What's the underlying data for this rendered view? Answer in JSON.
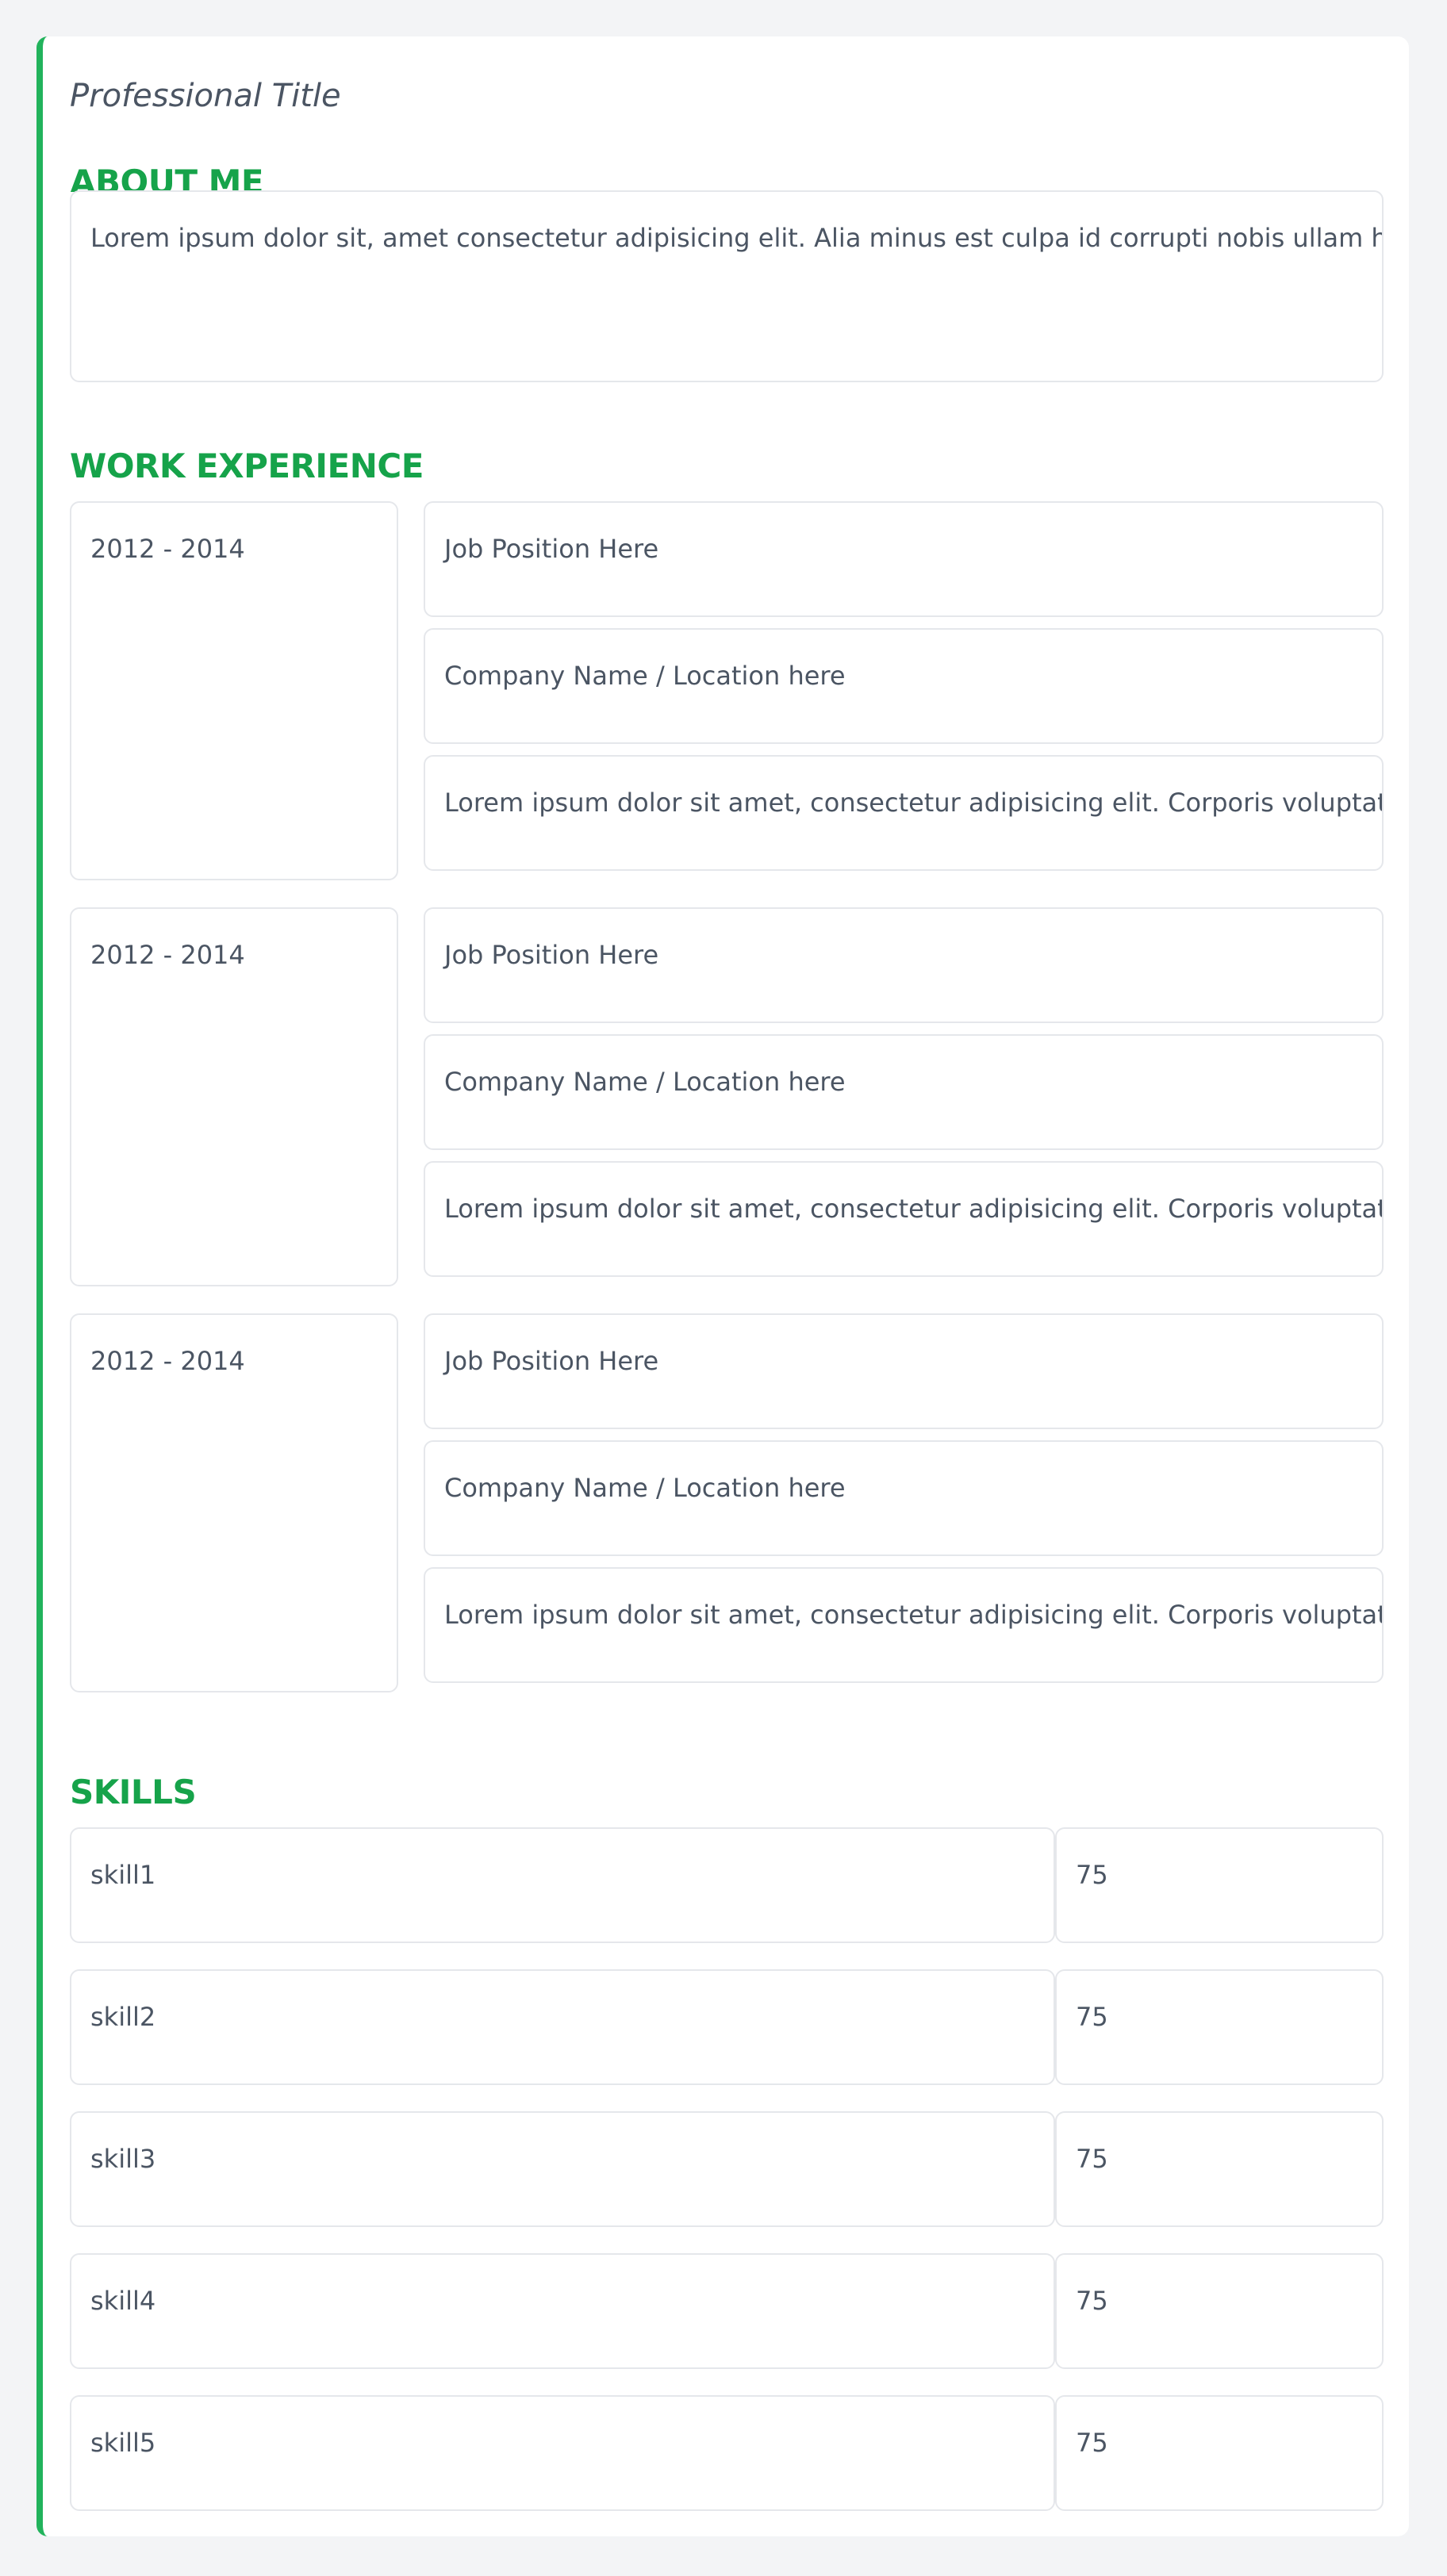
{
  "header": {
    "professional_title": "Professional Title"
  },
  "about": {
    "heading": "ABOUT ME",
    "text": "Lorem ipsum dolor sit, amet consectetur adipisicing elit. Alia minus est culpa id corrupti nobis ullam harum"
  },
  "work": {
    "heading": "WORK EXPERIENCE",
    "entries": [
      {
        "dates": "2012 - 2014",
        "position": "Job Position Here",
        "company": "Company Name / Location here",
        "description": "Lorem ipsum dolor sit amet, consectetur adipisicing elit. Corporis voluptatibus"
      },
      {
        "dates": "2012 - 2014",
        "position": "Job Position Here",
        "company": "Company Name / Location here",
        "description": "Lorem ipsum dolor sit amet, consectetur adipisicing elit. Corporis voluptatibus"
      },
      {
        "dates": "2012 - 2014",
        "position": "Job Position Here",
        "company": "Company Name / Location here",
        "description": "Lorem ipsum dolor sit amet, consectetur adipisicing elit. Corporis voluptatibus"
      }
    ]
  },
  "skills": {
    "heading": "SKILLS",
    "items": [
      {
        "name": "skill1",
        "level": "75"
      },
      {
        "name": "skill2",
        "level": "75"
      },
      {
        "name": "skill3",
        "level": "75"
      },
      {
        "name": "skill4",
        "level": "75"
      },
      {
        "name": "skill5",
        "level": "75"
      }
    ]
  },
  "colors": {
    "accent": "#16a34a",
    "accent_border": "#22b35c",
    "field_border": "#e5e7eb",
    "text": "#4b5563",
    "page_background": "#f3f4f6"
  }
}
